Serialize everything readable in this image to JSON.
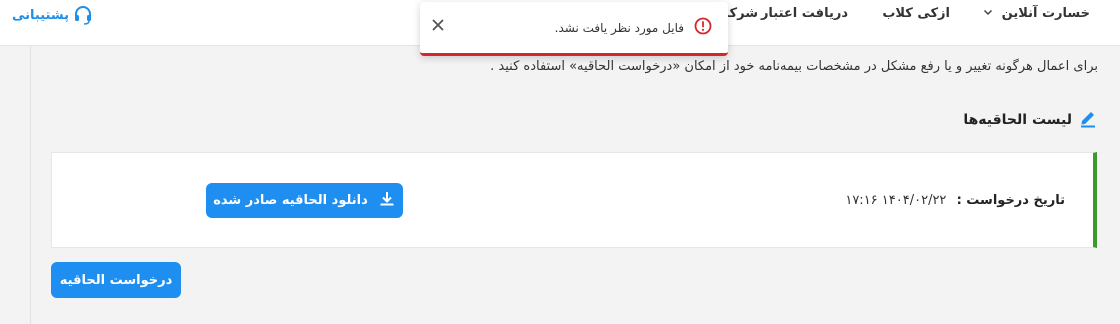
{
  "header": {
    "nav": [
      {
        "label": "خسارت آنلاین",
        "has_dropdown": true
      },
      {
        "label": "ازکی کلاب",
        "has_dropdown": false
      },
      {
        "label": "دریافت اعتبار",
        "has_dropdown": false
      },
      {
        "label": "شرکت",
        "has_dropdown": false
      }
    ],
    "support_label": "پشتیبانی"
  },
  "toast": {
    "message": "فایل مورد نظر یافت نشد.",
    "icon": "error-circle-icon",
    "close_icon": "close-icon"
  },
  "main": {
    "intro_text": "برای اعمال هرگونه تغییر و یا رفع مشکل در مشخصات بیمه‌نامه خود از امکان «درخواست الحاقیه» استفاده کنید .",
    "section_title": "لیست الحاقیه‌ها",
    "endorsements": [
      {
        "request_date_label": "تاریخ درخواست :",
        "request_date_value": "۱۴۰۴/۰۲/۲۲ ۱۷:۱۶",
        "download_label": "دانلود الحاقیه صادر شده"
      }
    ],
    "request_button_label": "درخواست الحاقیه"
  },
  "colors": {
    "accent": "#1e8ef0",
    "success_bar": "#3a9b2c",
    "error": "#d7262b"
  }
}
